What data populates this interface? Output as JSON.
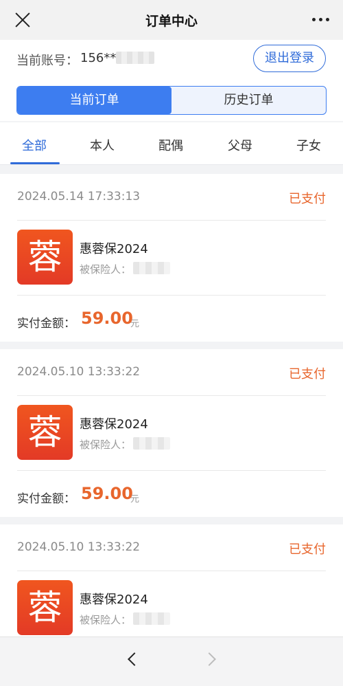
{
  "header": {
    "title": "订单中心"
  },
  "account": {
    "label": "当前账号：",
    "value": "156**",
    "logout_label": "退出登录"
  },
  "segments": [
    {
      "label": "当前订单"
    },
    {
      "label": "历史订单"
    }
  ],
  "filters": [
    {
      "label": "全部"
    },
    {
      "label": "本人"
    },
    {
      "label": "配偶"
    },
    {
      "label": "父母"
    },
    {
      "label": "子女"
    }
  ],
  "orders": [
    {
      "time": "2024.05.14 17:33:13",
      "status": "已支付",
      "logo_char": "蓉",
      "product": "惠蓉保2024",
      "insured_label": "被保险人：",
      "amount_label": "实付金额：",
      "amount": "59.00",
      "unit": "元"
    },
    {
      "time": "2024.05.10 13:33:22",
      "status": "已支付",
      "logo_char": "蓉",
      "product": "惠蓉保2024",
      "insured_label": "被保险人：",
      "amount_label": "实付金额：",
      "amount": "59.00",
      "unit": "元"
    },
    {
      "time": "2024.05.10 13:33:22",
      "status": "已支付",
      "logo_char": "蓉",
      "product": "惠蓉保2024",
      "insured_label": "被保险人："
    }
  ],
  "colors": {
    "accent": "#2f6bd9",
    "status": "#e8662d",
    "logo": "#e8472a"
  },
  "icons": {
    "close": "close-icon",
    "more": "more-icon",
    "back": "chevron-left-icon",
    "forward": "chevron-right-icon"
  }
}
